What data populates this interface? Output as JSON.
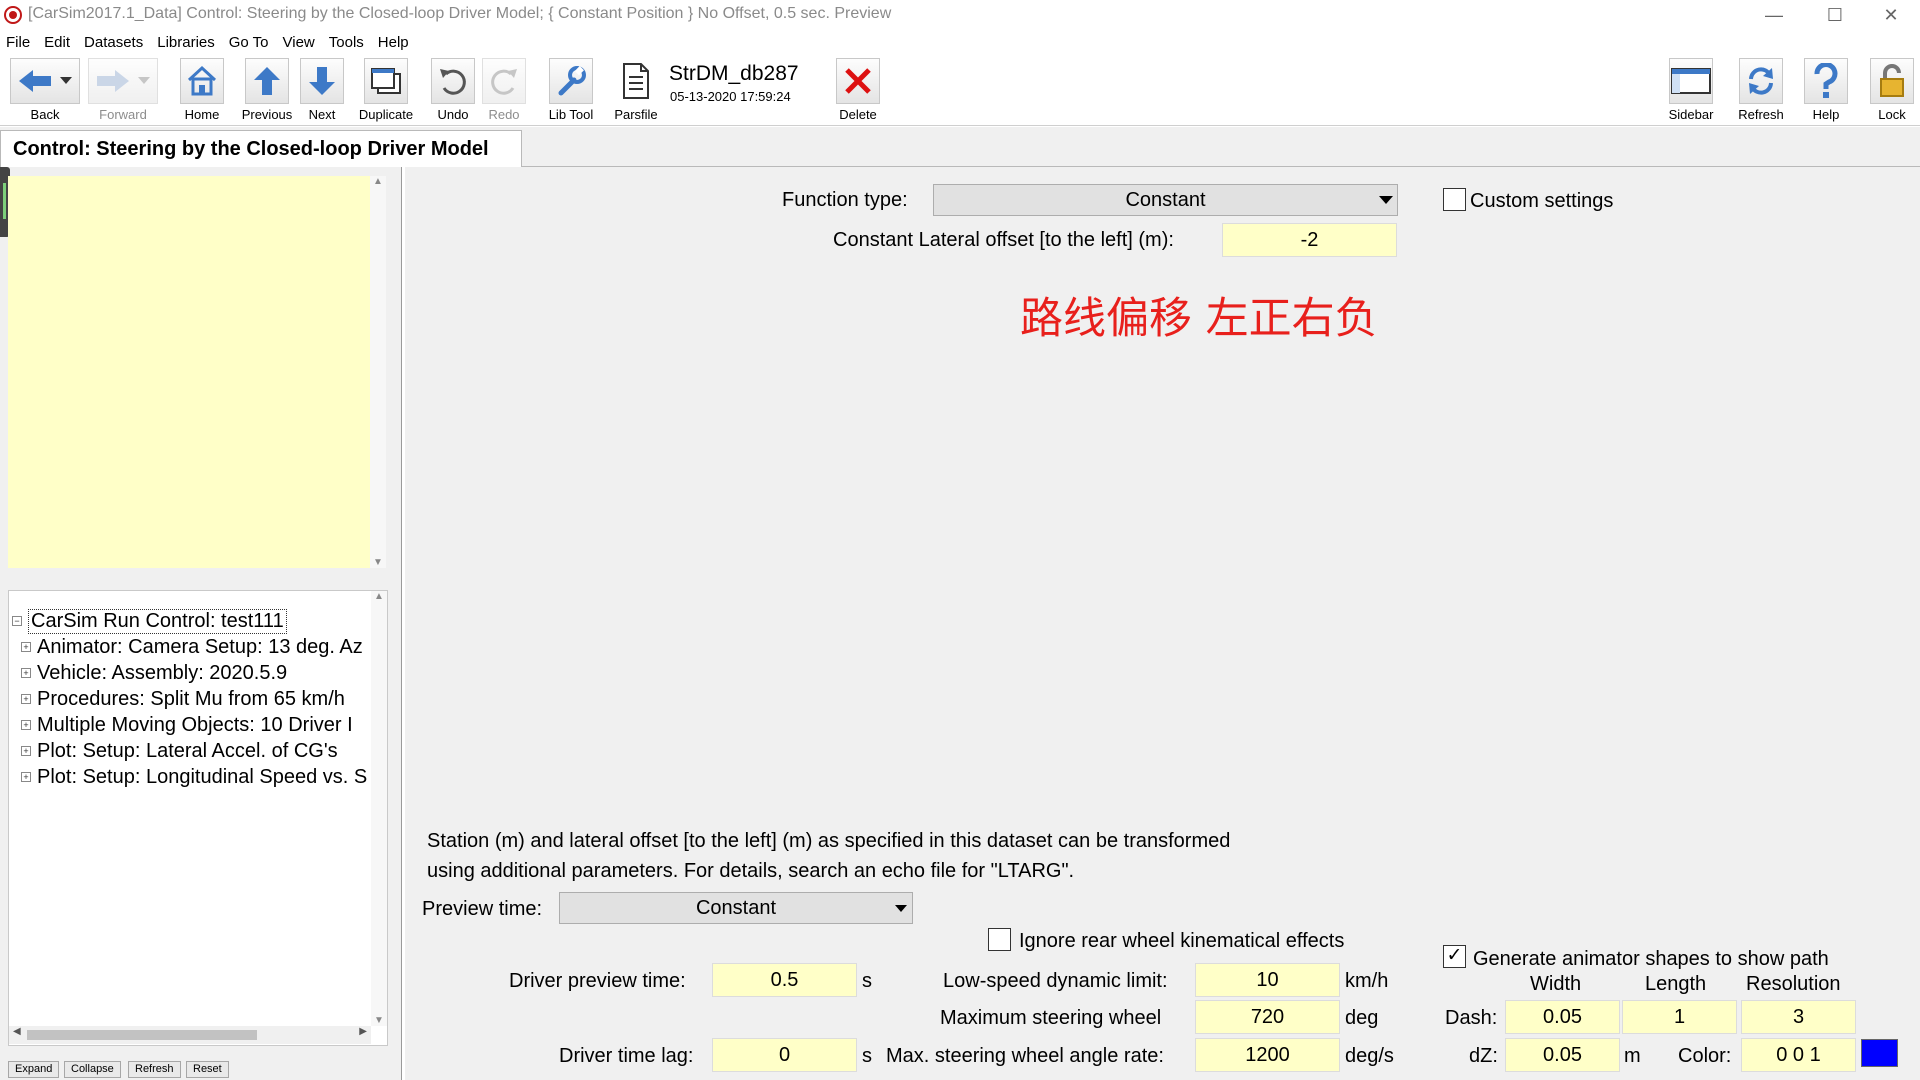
{
  "window": {
    "title": "[CarSim2017.1_Data] Control: Steering by the Closed-loop Driver Model; { Constant Position } No Offset, 0.5 sec. Preview",
    "minimize": "—",
    "maximize": "☐",
    "close": "✕"
  },
  "menu": [
    "File",
    "Edit",
    "Datasets",
    "Libraries",
    "Go To",
    "View",
    "Tools",
    "Help"
  ],
  "toolbar": {
    "back": "Back",
    "forward": "Forward",
    "home": "Home",
    "previous": "Previous",
    "next": "Next",
    "duplicate": "Duplicate",
    "undo": "Undo",
    "redo": "Redo",
    "lib_tool": "Lib Tool",
    "parsfile": "Parsfile",
    "dataset_name": "StrDM_db287",
    "dataset_date": "05-13-2020 17:59:24",
    "delete": "Delete",
    "sidebar": "Sidebar",
    "refresh": "Refresh",
    "help": "Help",
    "lock": "Lock"
  },
  "page_tab": "Control: Steering by the Closed-loop Driver Model",
  "tree": {
    "root": "CarSim Run Control: test111",
    "items": [
      "Animator: Camera Setup: 13 deg. Az",
      "Vehicle: Assembly: 2020.5.9",
      "Procedures: Split Mu from 65 km/h",
      "Multiple Moving Objects: 10 Driver I",
      "Plot: Setup: Lateral Accel. of CG's",
      "Plot: Setup: Longitudinal Speed vs. S"
    ]
  },
  "left_buttons": {
    "expand": "Expand",
    "collapse": "Collapse",
    "refresh": "Refresh",
    "reset": "Reset"
  },
  "main": {
    "function_type_label": "Function type:",
    "function_type_value": "Constant",
    "custom_settings_label": "Custom settings",
    "custom_settings_checked": false,
    "lateral_offset_label": "Constant Lateral offset [to the left] (m):",
    "lateral_offset_value": "-2",
    "annotation": "路线偏移 左正右负",
    "annotation_color": "#e8201c",
    "description_line1": "Station (m) and lateral offset [to the left] (m) as specified in this dataset can be transformed",
    "description_line2": "using additional parameters. For details, search an echo file for \"LTARG\".",
    "preview_time_label": "Preview time:",
    "preview_time_value": "Constant",
    "ignore_rear_label": "Ignore rear wheel kinematical effects",
    "ignore_rear_checked": false,
    "driver_preview_label": "Driver preview time:",
    "driver_preview_value": "0.5",
    "driver_preview_unit": "s",
    "driver_lag_label": "Driver time lag:",
    "driver_lag_value": "0",
    "driver_lag_unit": "s",
    "low_speed_label": "Low-speed dynamic limit:",
    "low_speed_value": "10",
    "low_speed_unit": "km/h",
    "max_steer_label": "Maximum steering wheel",
    "max_steer_value": "720",
    "max_steer_unit": "deg",
    "max_rate_label": "Max. steering wheel angle rate:",
    "max_rate_value": "1200",
    "max_rate_unit": "deg/s",
    "generate_shapes_label": "Generate animator shapes to show path",
    "generate_shapes_checked": true,
    "width_header": "Width",
    "length_header": "Length",
    "resolution_header": "Resolution",
    "dash_label": "Dash:",
    "dash_width": "0.05",
    "dash_length": "1",
    "dash_resolution": "3",
    "dz_label": "dZ:",
    "dz_value": "0.05",
    "dz_unit": "m",
    "color_label": "Color:",
    "color_value": "0 0 1",
    "color_swatch": "#0000ff"
  }
}
